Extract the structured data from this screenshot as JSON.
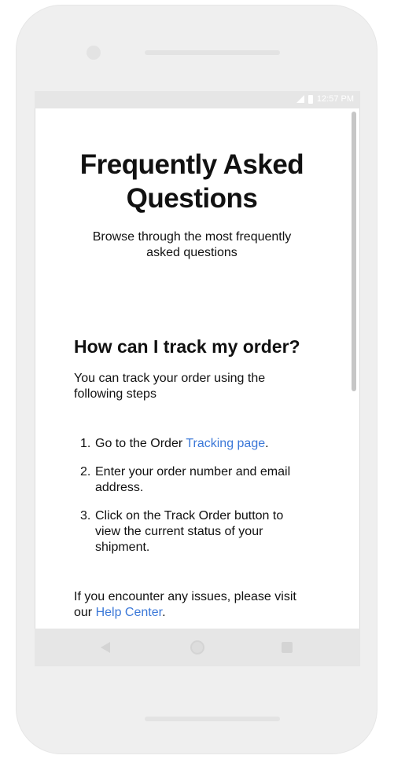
{
  "status_bar": {
    "time": "12:57 PM"
  },
  "page": {
    "title": "Frequently Asked Questions",
    "subtitle": "Browse through the most frequently asked questions"
  },
  "faq": {
    "question": "How can I track my order?",
    "answer": "You can track your order using the following steps",
    "steps": [
      {
        "num": "1.",
        "text_before": "Go to the Order ",
        "link": "Tracking page",
        "text_after": "."
      },
      {
        "num": "2.",
        "text": "Enter your order number and email address."
      },
      {
        "num": "3.",
        "text": "Click on the Track Order button to view the current status of your shipment."
      }
    ],
    "footer_before": "If you encounter any issues, please visit our ",
    "footer_link": "Help Center",
    "footer_after": "."
  },
  "colors": {
    "link": "#3b78d8",
    "frame": "#efefef",
    "bars": "#e6e6e6"
  },
  "icons": {
    "status": [
      "signal-icon",
      "battery-icon"
    ],
    "nav": [
      "back-icon",
      "home-icon",
      "recents-icon"
    ]
  }
}
